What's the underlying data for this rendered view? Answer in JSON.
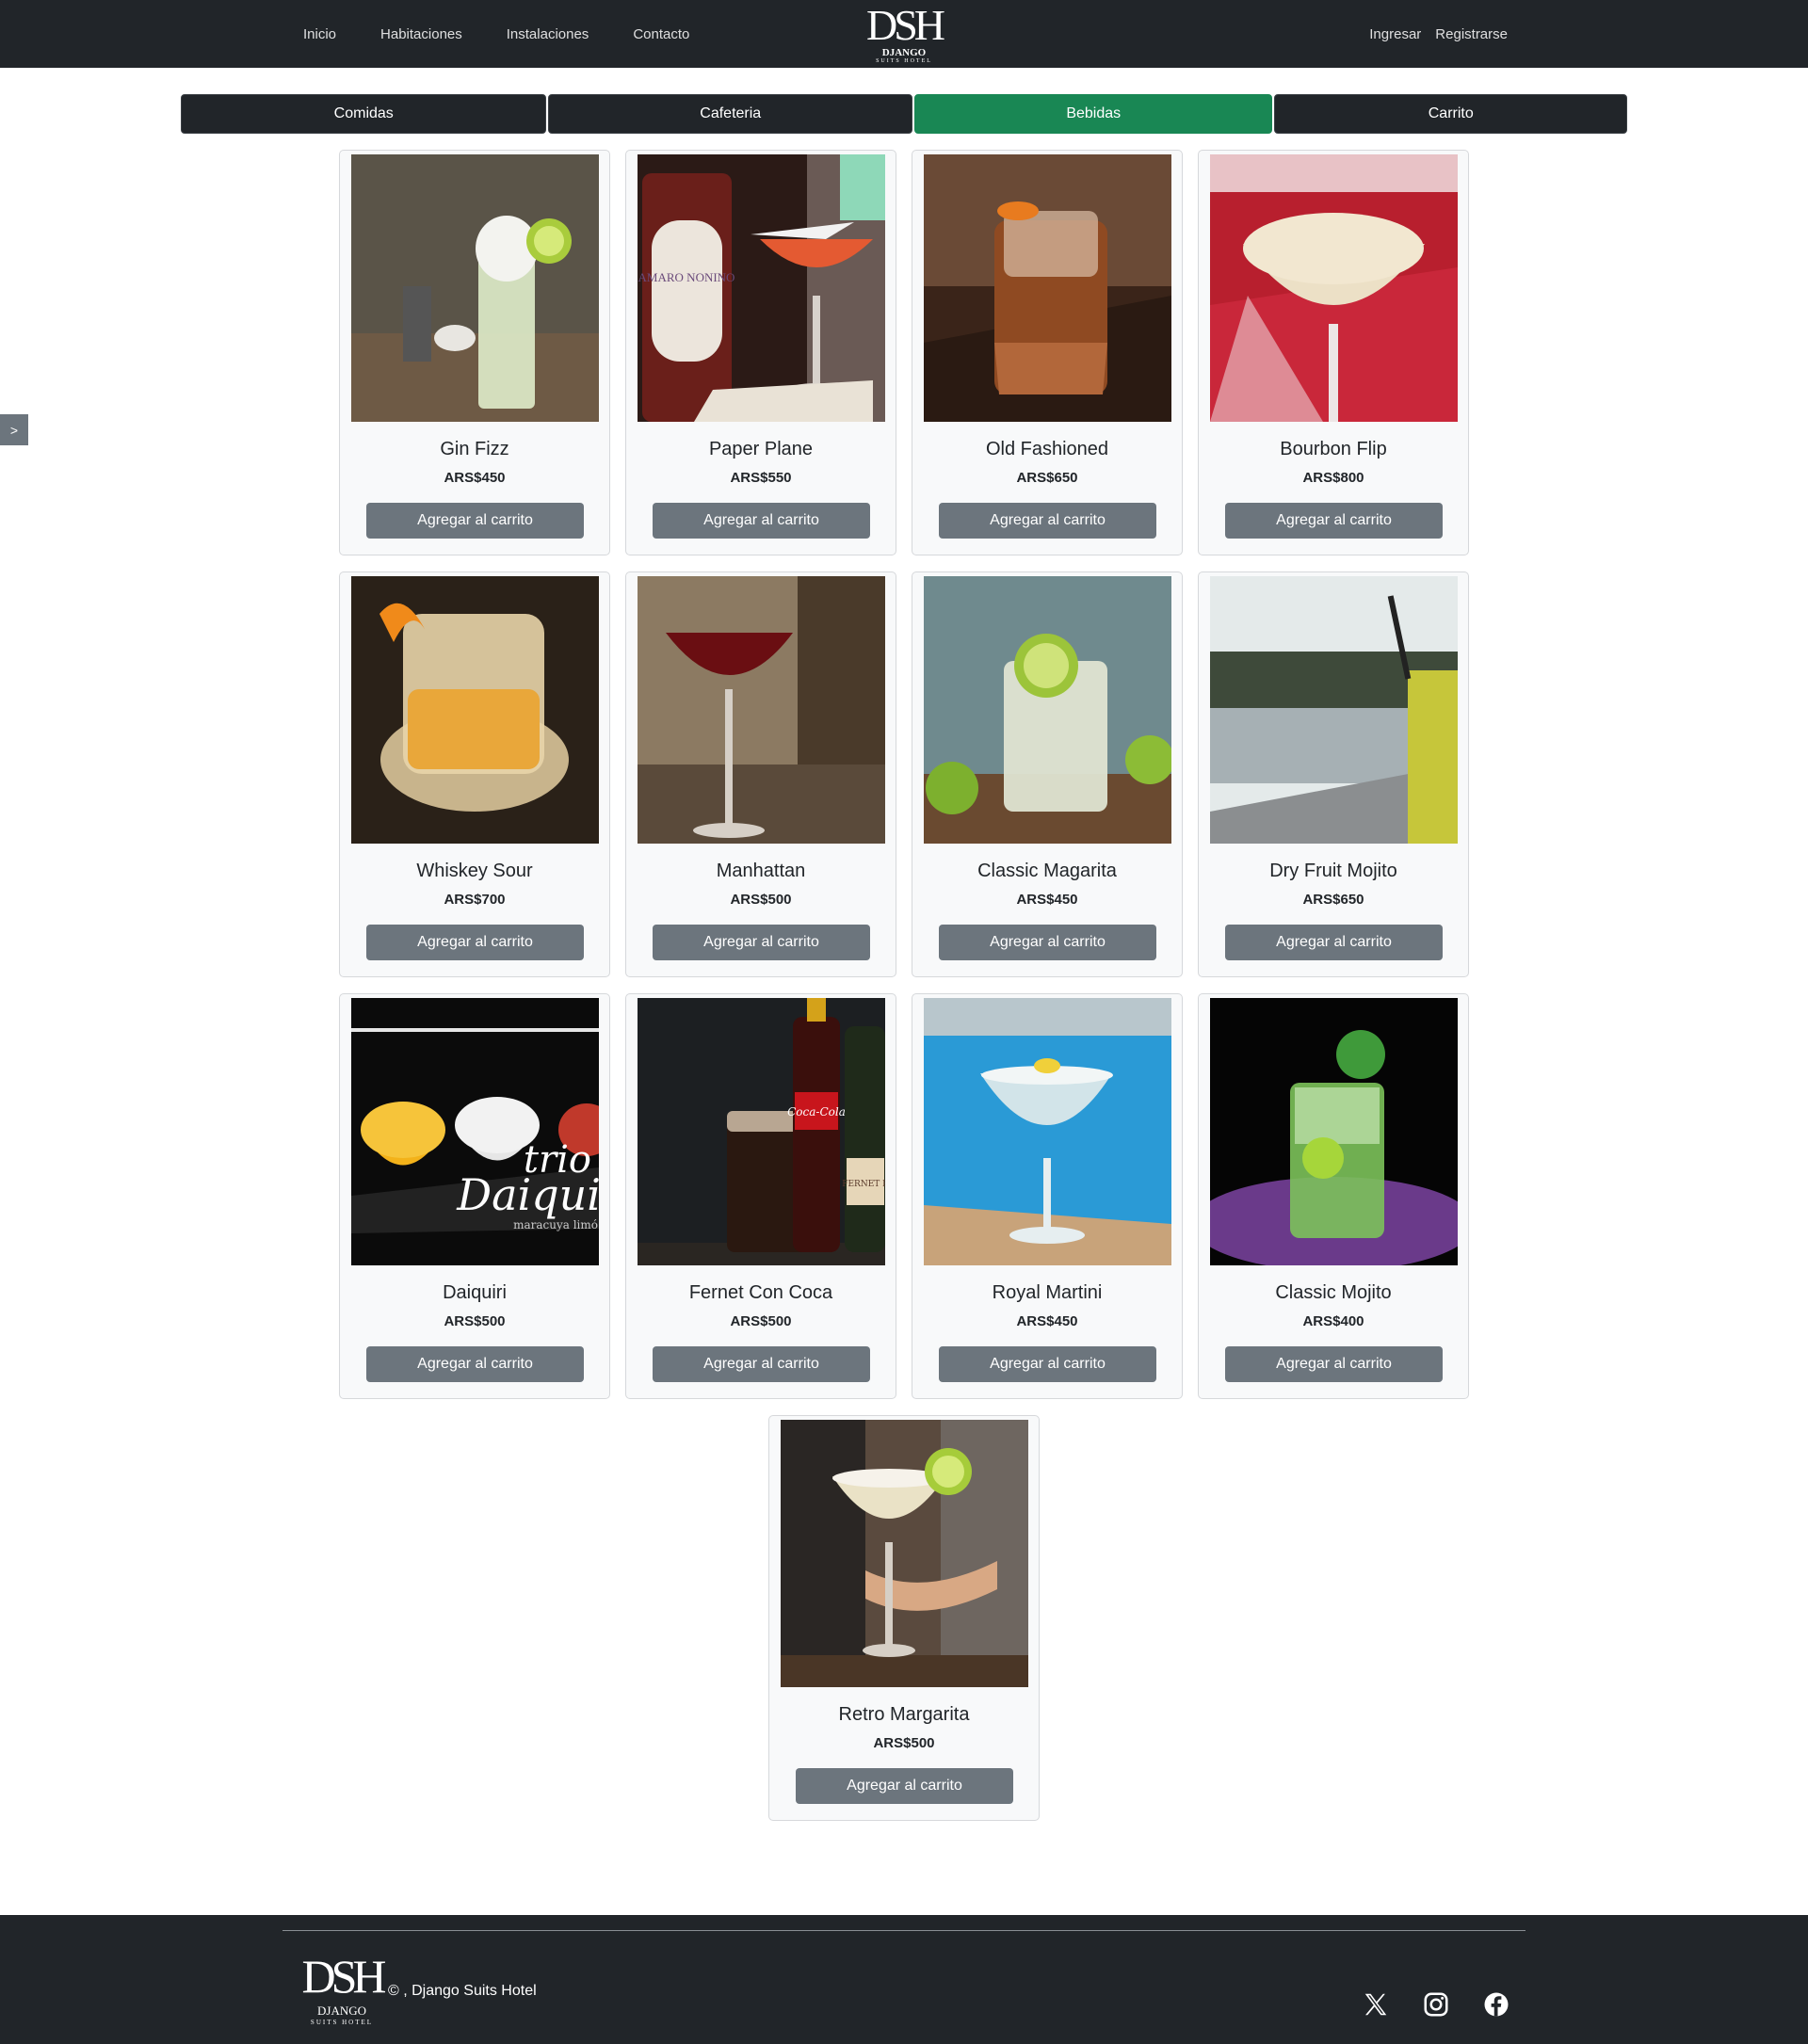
{
  "nav": {
    "links": [
      "Inicio",
      "Habitaciones",
      "Instalaciones",
      "Contacto"
    ],
    "brand": {
      "mono": "DSH",
      "line1": "DJANGO",
      "line2": "SUITS HOTEL"
    },
    "auth": [
      "Ingresar",
      "Registrarse"
    ]
  },
  "tabs": [
    "Comidas",
    "Cafeteria",
    "Bebidas",
    "Carrito"
  ],
  "active_tab": "Bebidas",
  "side_toggle": ">",
  "add_button_label": "Agregar al carrito",
  "products": [
    {
      "name": "Gin Fizz",
      "price": "ARS$450"
    },
    {
      "name": "Paper Plane",
      "price": "ARS$550"
    },
    {
      "name": "Old Fashioned",
      "price": "ARS$650"
    },
    {
      "name": "Bourbon Flip",
      "price": "ARS$800"
    },
    {
      "name": "Whiskey Sour",
      "price": "ARS$700"
    },
    {
      "name": "Manhattan",
      "price": "ARS$500"
    },
    {
      "name": "Classic Magarita",
      "price": "ARS$450"
    },
    {
      "name": "Dry Fruit Mojito",
      "price": "ARS$650"
    },
    {
      "name": "Daiquiri",
      "price": "ARS$500"
    },
    {
      "name": "Fernet Con Coca",
      "price": "ARS$500"
    },
    {
      "name": "Royal Martini",
      "price": "ARS$450"
    },
    {
      "name": "Classic Mojito",
      "price": "ARS$400"
    },
    {
      "name": "Retro Margarita",
      "price": "ARS$500"
    }
  ],
  "photo_texts": {
    "paper_plane_label": "AMARO NONINO",
    "daiquiri_line1": "trio",
    "daiquiri_line2": "Daiqui",
    "daiquiri_line3": "maracuya limó",
    "fernet_cola_label": "Coca-Cola",
    "fernet_label": "FERNET B"
  },
  "footer": {
    "logo": {
      "mono": "DSH",
      "line1": "DJANGO",
      "line2": "SUITS HOTEL"
    },
    "copyright": "© , Django Suits Hotel",
    "social_icons": [
      "x-icon",
      "instagram-icon",
      "facebook-icon"
    ]
  },
  "colors": {
    "navbar": "#212529",
    "tab_active": "#198754",
    "button": "#6c757d",
    "card_bg": "#f8f9fa"
  }
}
